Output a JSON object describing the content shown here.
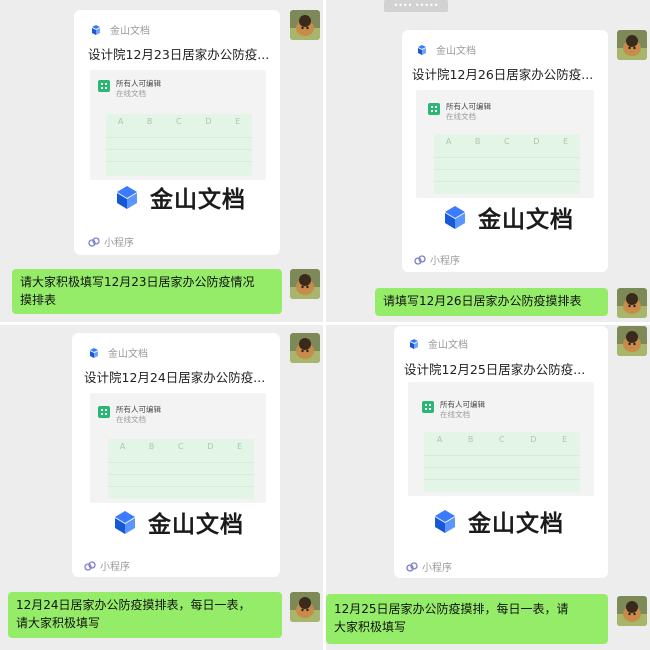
{
  "top_timestamp": "•••• •••••",
  "cards": [
    {
      "app_name": "金山文档",
      "title": "设计院12月23日居家办公防疫...",
      "sheet_label": "所有人可编辑",
      "sheet_sub": "在线文档",
      "columns": [
        "A",
        "B",
        "C",
        "D",
        "E"
      ],
      "brand": "金山文档",
      "footer": "小程序"
    },
    {
      "app_name": "金山文档",
      "title": "设计院12月26日居家办公防疫...",
      "sheet_label": "所有人可编辑",
      "sheet_sub": "在线文档",
      "columns": [
        "A",
        "B",
        "C",
        "D",
        "E"
      ],
      "brand": "金山文档",
      "footer": "小程序"
    },
    {
      "app_name": "金山文档",
      "title": "设计院12月24日居家办公防疫...",
      "sheet_label": "所有人可编辑",
      "sheet_sub": "在线文档",
      "columns": [
        "A",
        "B",
        "C",
        "D",
        "E"
      ],
      "brand": "金山文档",
      "footer": "小程序"
    },
    {
      "app_name": "金山文档",
      "title": "设计院12月25日居家办公防疫...",
      "sheet_label": "所有人可编辑",
      "sheet_sub": "在线文档",
      "columns": [
        "A",
        "B",
        "C",
        "D",
        "E"
      ],
      "brand": "金山文档",
      "footer": "小程序"
    }
  ],
  "messages": [
    {
      "lines": [
        "请大家积极填写12月23日居家办公防疫情况",
        "摸排表"
      ]
    },
    {
      "lines": [
        "请填写12月26日居家办公防疫摸排表"
      ]
    },
    {
      "lines": [
        "12月24日居家办公防疫摸排表，每日一表，",
        "请大家积极填写"
      ]
    },
    {
      "lines": [
        "12月25日居家办公防疫摸排，每日一表，请",
        "大家积极填写"
      ]
    }
  ],
  "colors": {
    "bubble": "#95ec69",
    "background": "#ededed",
    "card": "#ffffff",
    "sheet_green": "#2bb673",
    "wps_blue": "#1677ff"
  },
  "icons": {
    "app": "kingsoft-docs-icon",
    "sheet": "spreadsheet-icon",
    "footer": "mini-program-icon",
    "avatar": "user-avatar"
  }
}
